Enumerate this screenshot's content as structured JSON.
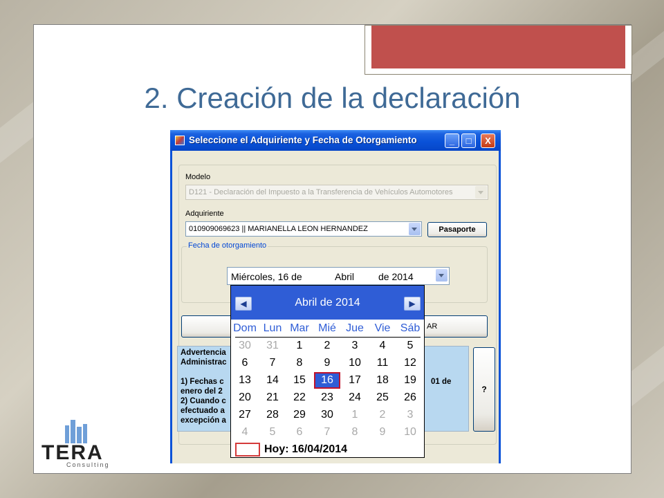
{
  "slide": {
    "title": "2. Creación de la declaración"
  },
  "dialog": {
    "title": "Seleccione el Adquiriente y Fecha de Otorgamiento",
    "controls": {
      "minimize": "_",
      "maximize": "□",
      "close": "X"
    },
    "modelo_label": "Modelo",
    "modelo_value": "D121 - Declaración del Impuesto a la Transferencia de Vehículos Automotores",
    "adquiriente_label": "Adquiriente",
    "adquiriente_value": "010909069623 || MARIANELLA LEON HERNANDEZ",
    "pasaporte_button": "Pasaporte",
    "fecha_group_label": "Fecha de otorgamiento",
    "date_weekday": "Miércoles, 16 de",
    "date_month": "Abril",
    "date_year": "de 2014",
    "wide_button_partial": "AR",
    "warning_lines": [
      "Advertencia",
      "Administrac",
      "",
      "1) Fechas c",
      "enero del 2",
      "2) Cuando c",
      "efectuado a",
      "excepción a"
    ],
    "warning_right_1": "01 de",
    "help_button": "?"
  },
  "calendar": {
    "month_label": "Abril de 2014",
    "prev_icon": "chevron-left-icon",
    "next_icon": "chevron-right-icon",
    "weekdays": [
      "Dom",
      "Lun",
      "Mar",
      "Mié",
      "Jue",
      "Vie",
      "Sáb"
    ],
    "weeks": [
      [
        "30",
        "31",
        "1",
        "2",
        "3",
        "4",
        "5"
      ],
      [
        "6",
        "7",
        "8",
        "9",
        "10",
        "11",
        "12"
      ],
      [
        "13",
        "14",
        "15",
        "16",
        "17",
        "18",
        "19"
      ],
      [
        "20",
        "21",
        "22",
        "23",
        "24",
        "25",
        "26"
      ],
      [
        "27",
        "28",
        "29",
        "30",
        "1",
        "2",
        "3"
      ],
      [
        "4",
        "5",
        "6",
        "7",
        "8",
        "9",
        "10"
      ]
    ],
    "selected_day": "16",
    "today_label": "Hoy: 16/04/2014"
  },
  "logo": {
    "name": "TERA",
    "sub": "Consulting"
  },
  "colors": {
    "title_blue": "#3f6a96",
    "accent_red": "#c0504d",
    "calendar_blue": "#2f5dd6",
    "warning_bg": "#b8d8f0"
  }
}
